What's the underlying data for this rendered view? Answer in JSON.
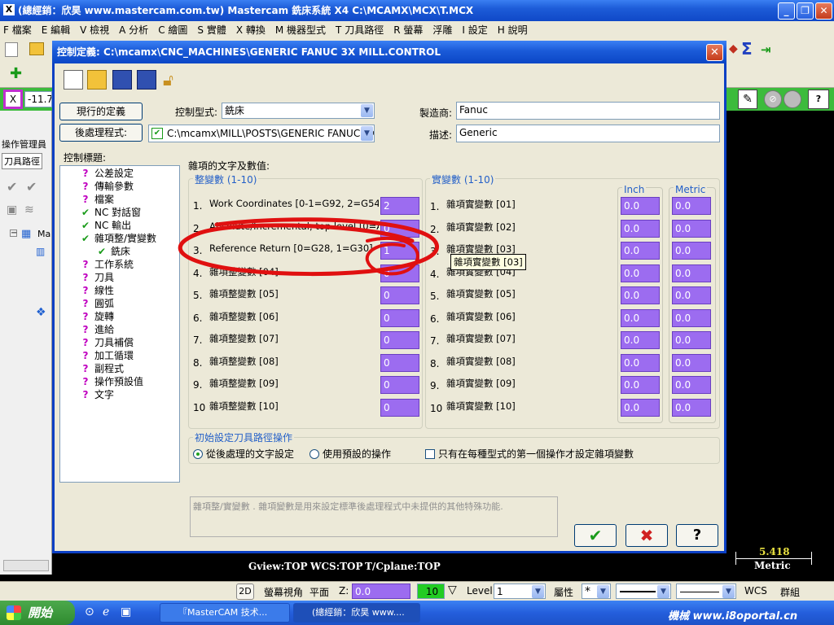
{
  "app": {
    "title": "(總經銷：欣昊 www.mastercam.com.tw) Mastercam 銑床系統 X4   C:\\MCAMX\\MCX\\T.MCX",
    "menu": [
      "F 檔案",
      "E 編輯",
      "V 檢視",
      "A 分析",
      "C 繪圖",
      "S 實體",
      "X 轉換",
      "M 機器型式",
      "T 刀具路徑",
      "R 螢幕",
      "浮雕",
      "I 設定",
      "H 說明"
    ],
    "coord_x_label": "X",
    "coord_x_value": "-11.72",
    "left_panel_tab1": "操作管理員",
    "left_panel_tab2": "刀具路徑",
    "left_panel_node": "Ma"
  },
  "dialog": {
    "title": "控制定義: C:\\mcamx\\CNC_MACHINES\\GENERIC FANUC 3X MILL.CONTROL",
    "btn_current": "現行的定義",
    "btn_post": "後處理程式:",
    "control_type_label": "控制型式:",
    "control_type_value": "銑床",
    "post_path": "C:\\mcamx\\MILL\\POSTS\\GENERIC FANUC 3X M",
    "manufacturer_label": "製造商:",
    "manufacturer_value": "Fanuc",
    "desc_label": "描述:",
    "desc_value": "Generic",
    "topics_label": "控制標題:",
    "misc_header": "雜項的文字及數值:",
    "int_group_title": "整變數 (1-10)",
    "real_group_title": "實變數 (1-10)",
    "inch_label": "Inch",
    "metric_label": "Metric",
    "init_group_title": "初始設定刀具路徑操作",
    "radio1": "從後處理的文字設定",
    "radio2": "使用預設的操作",
    "check1": "只有在每種型式的第一個操作才設定雜項變數",
    "desc_box": "雜項整/實變數 . 雜項變數是用來設定標準後處理程式中未提供的其他特殊功能.",
    "tooltip": "雜項實變數 [03]",
    "ok_symbol": "✔",
    "cancel_symbol": "✖",
    "help_symbol": "?"
  },
  "tree": [
    {
      "label": "公差設定",
      "icon": "?",
      "kind": "q"
    },
    {
      "label": "傳輸參數",
      "icon": "?",
      "kind": "q"
    },
    {
      "label": "檔案",
      "icon": "?",
      "kind": "q"
    },
    {
      "label": "NC 對話窗",
      "icon": "✔",
      "kind": "ck"
    },
    {
      "label": "NC 輸出",
      "icon": "✔",
      "kind": "ck"
    },
    {
      "label": "雜項整/實變數",
      "icon": "✔",
      "kind": "ck"
    },
    {
      "label": "銑床",
      "icon": "✔",
      "kind": "ck",
      "child": true
    },
    {
      "label": "工作系統",
      "icon": "?",
      "kind": "q"
    },
    {
      "label": "刀具",
      "icon": "?",
      "kind": "q"
    },
    {
      "label": "線性",
      "icon": "?",
      "kind": "q"
    },
    {
      "label": "圓弧",
      "icon": "?",
      "kind": "q"
    },
    {
      "label": "旋轉",
      "icon": "?",
      "kind": "q"
    },
    {
      "label": "進給",
      "icon": "?",
      "kind": "q"
    },
    {
      "label": "刀具補償",
      "icon": "?",
      "kind": "q"
    },
    {
      "label": "加工循環",
      "icon": "?",
      "kind": "q"
    },
    {
      "label": "副程式",
      "icon": "?",
      "kind": "q"
    },
    {
      "label": "操作預設值",
      "icon": "?",
      "kind": "q"
    },
    {
      "label": "文字",
      "icon": "?",
      "kind": "q"
    }
  ],
  "int_vars": [
    {
      "num": "1.",
      "label": "Work Coordinates [0-1=G92, 2=G54's]",
      "value": "2"
    },
    {
      "num": "2.",
      "label": "Absolute/Incremental, top level [0=ABS, 1=INC]",
      "value": "0"
    },
    {
      "num": "3.",
      "label": "Reference Return [0=G28, 1=G30]",
      "value": "1"
    },
    {
      "num": "4.",
      "label": "雜項整變數 [04]",
      "value": "0"
    },
    {
      "num": "5.",
      "label": "雜項整變數 [05]",
      "value": "0"
    },
    {
      "num": "6.",
      "label": "雜項整變數 [06]",
      "value": "0"
    },
    {
      "num": "7.",
      "label": "雜項整變數 [07]",
      "value": "0"
    },
    {
      "num": "8.",
      "label": "雜項整變數 [08]",
      "value": "0"
    },
    {
      "num": "9.",
      "label": "雜項整變數 [09]",
      "value": "0"
    },
    {
      "num": "10",
      "label": "雜項整變數 [10]",
      "value": "0"
    }
  ],
  "real_vars": [
    {
      "num": "1.",
      "label": "雜項實變數 [01]",
      "inch": "0.0",
      "metric": "0.0"
    },
    {
      "num": "2.",
      "label": "雜項實變數 [02]",
      "inch": "0.0",
      "metric": "0.0"
    },
    {
      "num": "3.",
      "label": "雜項實變數 [03]",
      "inch": "0.0",
      "metric": "0.0"
    },
    {
      "num": "4.",
      "label": "雜項實變數 [04]",
      "inch": "0.0",
      "metric": "0.0"
    },
    {
      "num": "5.",
      "label": "雜項實變數 [05]",
      "inch": "0.0",
      "metric": "0.0"
    },
    {
      "num": "6.",
      "label": "雜項實變數 [06]",
      "inch": "0.0",
      "metric": "0.0"
    },
    {
      "num": "7.",
      "label": "雜項實變數 [07]",
      "inch": "0.0",
      "metric": "0.0"
    },
    {
      "num": "8.",
      "label": "雜項實變數 [08]",
      "inch": "0.0",
      "metric": "0.0"
    },
    {
      "num": "9.",
      "label": "雜項實變數 [09]",
      "inch": "0.0",
      "metric": "0.0"
    },
    {
      "num": "10",
      "label": "雜項實變數 [10]",
      "inch": "0.0",
      "metric": "0.0"
    }
  ],
  "graphics": {
    "gview": "Gview:TOP",
    "wcs": "WCS:TOP",
    "tcplane": "T/Cplane:TOP",
    "scale_value": "5.418",
    "scale_unit": "Metric"
  },
  "status": {
    "mode2d": "2D",
    "screen_view": "螢幕視角",
    "plane": "平面",
    "z_label": "Z:",
    "z_value": "0.0",
    "color_value": "10",
    "level_label": "Level:",
    "level_value": "1",
    "attr": "屬性",
    "wcs": "WCS",
    "group": "群組"
  },
  "taskbar": {
    "start": "開始",
    "task1": "『MasterCAM 技术...",
    "task2": "(總經銷：欣昊 www....",
    "watermark": "機械 www.i8oportal.cn"
  }
}
